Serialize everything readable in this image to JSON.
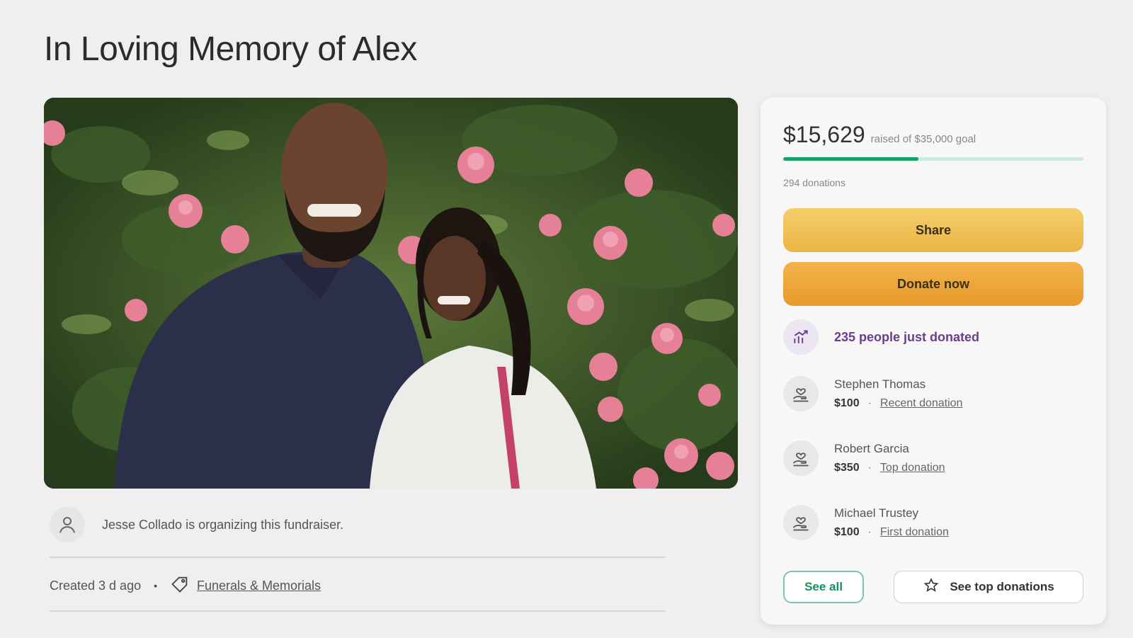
{
  "page": {
    "title": "In Loving Memory of Alex"
  },
  "organizer": {
    "text": "Jesse Collado is organizing this fundraiser."
  },
  "meta": {
    "created": "Created 3 d ago",
    "separator": "•",
    "category": "Funerals & Memorials"
  },
  "donation_card": {
    "raised_amount": "$15,629",
    "raised_goal": "raised of $35,000 goal",
    "progress_fraction": 0.45,
    "donations_count": "294 donations",
    "share_label": "Share",
    "donate_label": "Donate now",
    "trend_text": "235 people just donated",
    "donors": [
      {
        "name": "Stephen Thomas",
        "amount": "$100",
        "sep": "·",
        "tag": "Recent donation"
      },
      {
        "name": "Robert Garcia",
        "amount": "$350",
        "sep": "·",
        "tag": "Top donation"
      },
      {
        "name": "Michael Trustey",
        "amount": "$100",
        "sep": "·",
        "tag": "First donation"
      }
    ],
    "see_all_label": "See all",
    "see_top_label": "See top donations"
  },
  "colors": {
    "progress": "#12a366",
    "share_button": "#ecb545",
    "donate_button": "#e89b2a",
    "trend_text": "#6b3d8c",
    "see_all_border": "#7fc5a3"
  },
  "icons": {
    "organizer": "user-icon",
    "category": "tag-icon",
    "trend": "trending-up-icon",
    "donor": "donor-hand-heart-icon",
    "see_top": "star-icon"
  }
}
